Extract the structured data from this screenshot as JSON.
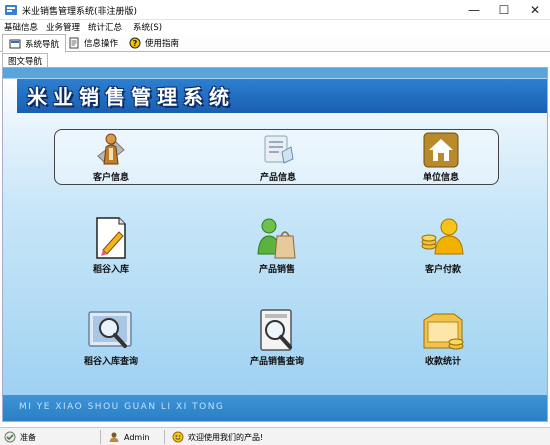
{
  "window": {
    "title": "米业销售管理系统(非注册版)",
    "controls": {
      "minimize": "—",
      "maximize": "☐",
      "close": "✕"
    }
  },
  "menu": {
    "items": [
      "基础信息",
      "业务管理",
      "统计汇总",
      "系统(S)"
    ]
  },
  "tabs": [
    {
      "label": "系统导航",
      "icon": "navigation-icon",
      "active": true
    },
    {
      "label": "信息操作",
      "icon": "info-icon",
      "active": false
    },
    {
      "label": "使用指南",
      "icon": "help-icon",
      "active": false
    }
  ],
  "subtab": {
    "label": "图文导航"
  },
  "banner": {
    "title": "米业销售管理系统"
  },
  "quick_links": [
    {
      "label": "客户信息",
      "icon": "customer-icon"
    },
    {
      "label": "产品信息",
      "icon": "product-info-icon"
    },
    {
      "label": "单位信息",
      "icon": "unit-home-icon"
    }
  ],
  "functions": [
    {
      "label": "稻谷入库",
      "icon": "rice-inbound-icon"
    },
    {
      "label": "产品销售",
      "icon": "product-sales-icon"
    },
    {
      "label": "客户付款",
      "icon": "customer-payment-icon"
    },
    {
      "label": "稻谷入库查询",
      "icon": "inbound-query-icon"
    },
    {
      "label": "产品销售查询",
      "icon": "sales-query-icon"
    },
    {
      "label": "收款统计",
      "icon": "collection-stats-icon"
    }
  ],
  "footer": {
    "pinyin": "MI YE XIAO SHOU GUAN LI XI TONG"
  },
  "status": {
    "ready": "准备",
    "user": "Admin",
    "welcome": "欢迎使用我们的产品!"
  },
  "colors": {
    "banner": "#1a5fb1",
    "top_stripe": "#58a5dc",
    "footer_band": "#2a7fc6",
    "footer_text": "#bfe0ff"
  }
}
